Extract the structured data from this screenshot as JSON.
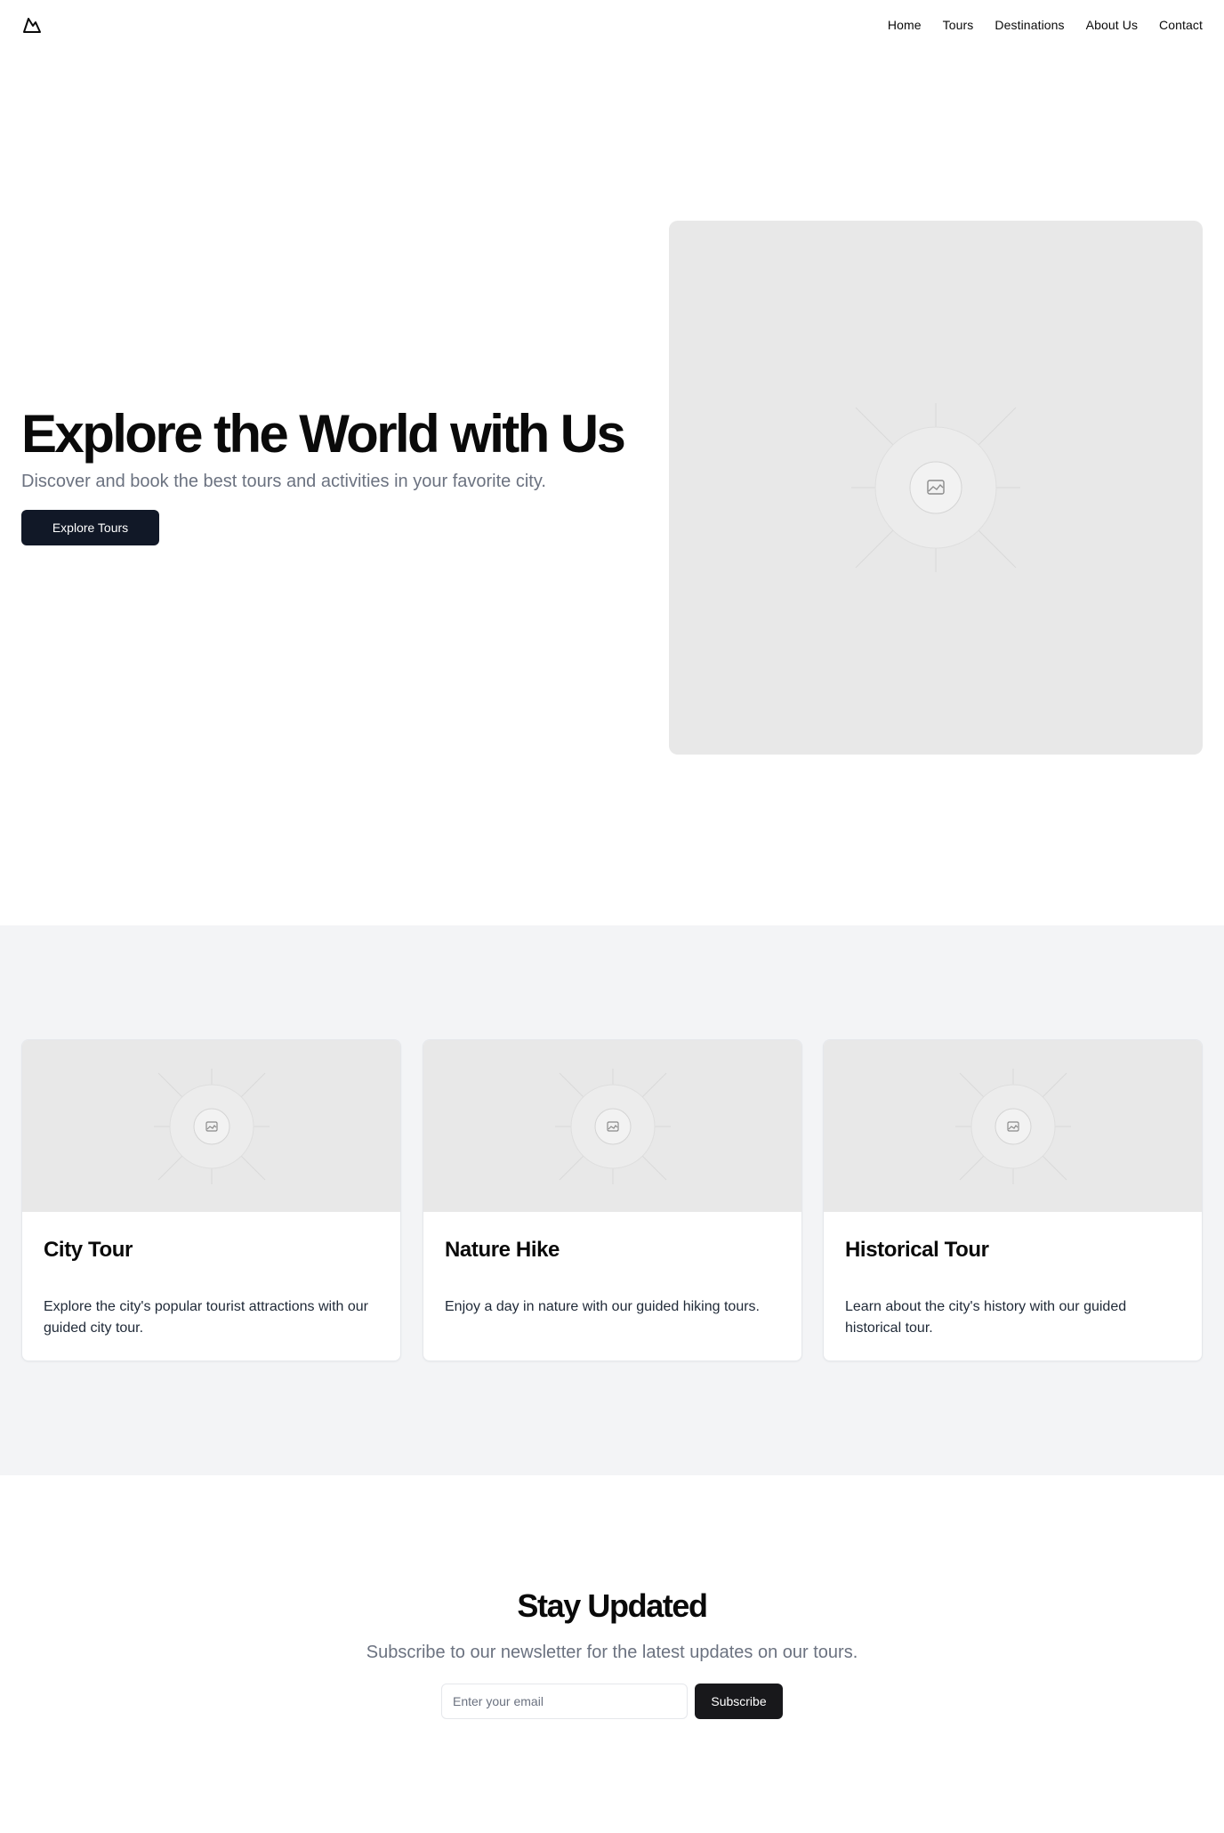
{
  "header": {
    "logo_icon": "mountain-icon",
    "nav": [
      {
        "label": "Home"
      },
      {
        "label": "Tours"
      },
      {
        "label": "Destinations"
      },
      {
        "label": "About Us"
      },
      {
        "label": "Contact"
      }
    ]
  },
  "hero": {
    "title": "Explore the World with Us",
    "subtitle": "Discover and book the best tours and activities in your favorite city.",
    "button_label": "Explore Tours",
    "image_icon": "image-placeholder-icon"
  },
  "tours": {
    "cards": [
      {
        "title": "City Tour",
        "description": "Explore the city's popular tourist attractions with our guided city tour.",
        "image_icon": "image-placeholder-icon"
      },
      {
        "title": "Nature Hike",
        "description": "Enjoy a day in nature with our guided hiking tours.",
        "image_icon": "image-placeholder-icon"
      },
      {
        "title": "Historical Tour",
        "description": "Learn about the city's history with our guided historical tour.",
        "image_icon": "image-placeholder-icon"
      }
    ]
  },
  "newsletter": {
    "title": "Stay Updated",
    "subtitle": "Subscribe to our newsletter for the latest updates on our tours.",
    "email_placeholder": "Enter your email",
    "email_value": "",
    "button_label": "Subscribe"
  },
  "colors": {
    "primary_dark": "#111827",
    "button_dark": "#18181b",
    "muted_text": "#6b7280",
    "section_bg": "#f3f4f6",
    "placeholder_bg": "#e8e8e8"
  }
}
